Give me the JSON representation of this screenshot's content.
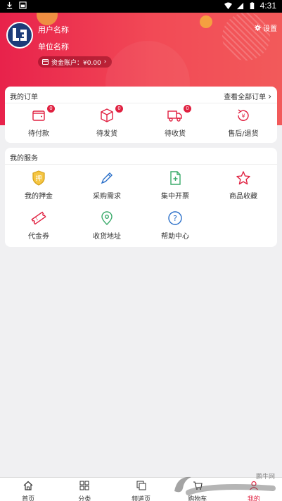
{
  "status_bar": {
    "time": "4:31"
  },
  "header": {
    "username": "用户名称",
    "company": "单位名称",
    "fund_account": "资金账户：¥0.00",
    "settings_label": "设置"
  },
  "orders": {
    "title": "我的订单",
    "view_all": "查看全部订单",
    "items": [
      {
        "label": "待付款",
        "badge": "0",
        "icon": "wallet-icon"
      },
      {
        "label": "待发货",
        "badge": "0",
        "icon": "package-icon"
      },
      {
        "label": "待收货",
        "badge": "0",
        "icon": "truck-icon"
      },
      {
        "label": "售后/退货",
        "icon": "refund-icon"
      }
    ]
  },
  "services": {
    "title": "我的服务",
    "items": [
      {
        "label": "我的押金",
        "icon": "deposit-icon"
      },
      {
        "label": "采购需求",
        "icon": "pencil-icon"
      },
      {
        "label": "集中开票",
        "icon": "invoice-icon"
      },
      {
        "label": "商品收藏",
        "icon": "star-icon"
      },
      {
        "label": "代金券",
        "icon": "ticket-icon"
      },
      {
        "label": "收货地址",
        "icon": "location-icon"
      },
      {
        "label": "帮助中心",
        "icon": "help-icon"
      }
    ]
  },
  "tabbar": {
    "items": [
      {
        "label": "首页",
        "icon": "home-icon"
      },
      {
        "label": "分类",
        "icon": "category-icon"
      },
      {
        "label": "频道页",
        "icon": "channel-icon"
      },
      {
        "label": "购物车",
        "icon": "cart-icon"
      },
      {
        "label": "我的",
        "icon": "user-icon"
      }
    ]
  },
  "watermark": {
    "text": "鹏牛网"
  },
  "colors": {
    "header_red": "#e8224b",
    "accent_red": "#e02040",
    "avatar_blue": "#1c3c79",
    "green": "#3aaa6a",
    "blue": "#2a6fc9",
    "gold": "#d4a017"
  }
}
